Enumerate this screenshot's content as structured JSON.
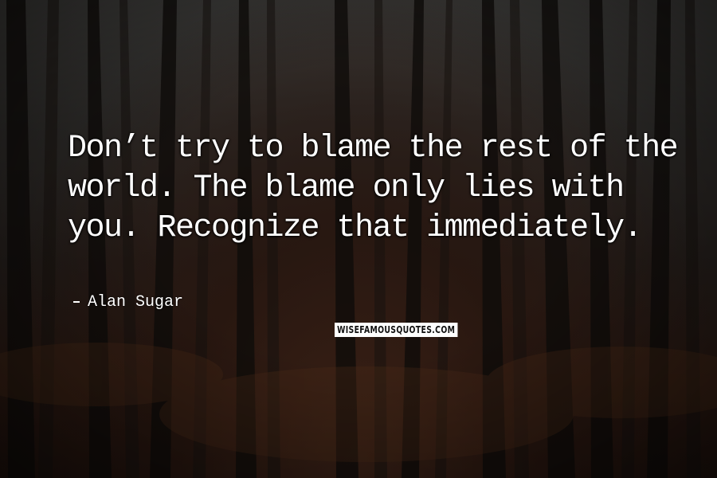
{
  "quote": {
    "text": "Don’t try to blame the rest of the world. The blame only lies with you. Recognize that immediately."
  },
  "author": {
    "name": "Alan Sugar"
  },
  "watermark": {
    "text": "WISEFAMOUSQUOTES.COM"
  },
  "colors": {
    "text": "#ffffff",
    "background_dark": "#1c1816",
    "foliage": "#3a2116"
  }
}
